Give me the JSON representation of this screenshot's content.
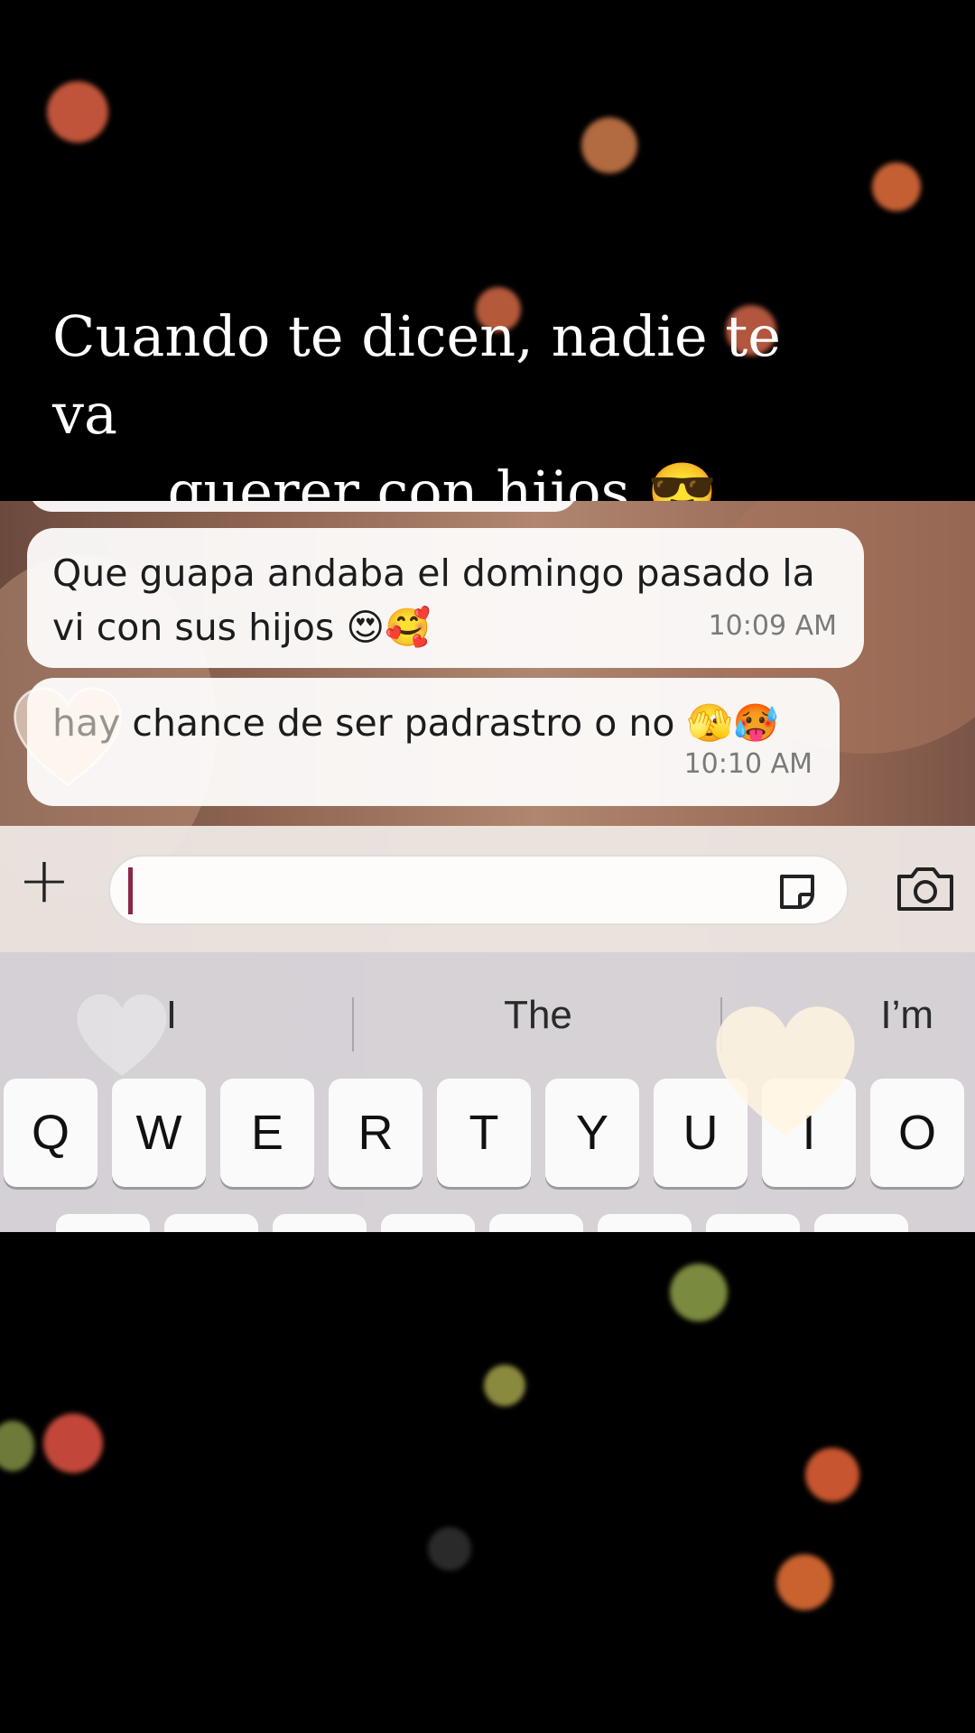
{
  "caption": {
    "line1": "Cuando te dicen, nadie te va",
    "line2": "querer con hijos 😎"
  },
  "chat": {
    "messages": [
      {
        "text": "Que guapa andaba el domingo pasado la vi con sus hijos 😍🥰",
        "time": "10:09 AM"
      },
      {
        "text": "hay chance de ser padrastro o no 🫣🥵",
        "time": "10:10 AM"
      }
    ]
  },
  "input_bar": {
    "plus_label": "+",
    "message_value": "",
    "icons": [
      "plus-icon",
      "sticker-icon",
      "camera-icon"
    ]
  },
  "keyboard": {
    "suggestions": [
      "I",
      "The",
      "I’m"
    ],
    "keys": [
      "Q",
      "W",
      "E",
      "R",
      "T",
      "Y",
      "U",
      "I",
      "O"
    ]
  },
  "colors": {
    "background": "#000000",
    "caption_text": "#ffffff",
    "bubble": "#ffffff",
    "caret": "#8a2744"
  }
}
